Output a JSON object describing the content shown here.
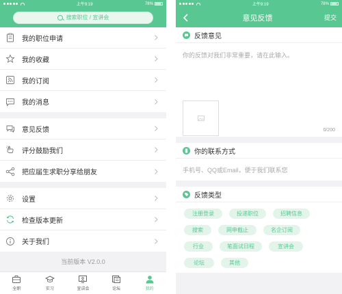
{
  "colors": {
    "accent": "#58c792",
    "tag_bg": "#e3f5eb",
    "page_bg": "#f2f2f4"
  },
  "left": {
    "status": {
      "time": "上午9:19",
      "battery": "78%"
    },
    "search": {
      "placeholder": "搜索职位 / 宣讲会",
      "icon": "search-icon"
    },
    "groups": [
      [
        {
          "label": "我的职位申请",
          "icon": "clipboard-icon"
        },
        {
          "label": "我的收藏",
          "icon": "star-icon"
        },
        {
          "label": "我的订阅",
          "icon": "rss-icon"
        },
        {
          "label": "我的消息",
          "icon": "message-icon"
        }
      ],
      [
        {
          "label": "意见反馈",
          "icon": "feedback-icon"
        },
        {
          "label": "评分鼓励我们",
          "icon": "thumbs-up-icon"
        },
        {
          "label": "把应届生求职分享给朋友",
          "icon": "share-icon"
        }
      ],
      [
        {
          "label": "设置",
          "icon": "gear-icon"
        },
        {
          "label": "检查版本更新",
          "icon": "refresh-icon"
        },
        {
          "label": "关于我们",
          "icon": "info-icon"
        }
      ]
    ],
    "version": "当前版本 V2.0.0",
    "tabs": [
      {
        "label": "全职",
        "icon": "briefcase-icon",
        "active": false
      },
      {
        "label": "实习",
        "icon": "graduation-cap-icon",
        "active": false
      },
      {
        "label": "宣讲会",
        "icon": "presentation-icon",
        "active": false
      },
      {
        "label": "论坛",
        "icon": "forum-icon",
        "active": false
      },
      {
        "label": "我的",
        "icon": "user-icon",
        "active": true
      }
    ]
  },
  "right": {
    "status": {
      "time": "上午9:19",
      "battery": "78%"
    },
    "header": {
      "title": "意见反馈",
      "submit": "提交"
    },
    "feedback": {
      "title": "反馈意见",
      "placeholder": "你的反馈对我们非常重要，请在此输入。",
      "counter": "0/200"
    },
    "contact": {
      "title": "你的联系方式",
      "placeholder": "手机号、QQ或Email，便于我们联系您"
    },
    "types": {
      "title": "反馈类型",
      "tags": [
        "注册登录",
        "投递职位",
        "招聘信息",
        "搜索",
        "网申截止",
        "名企订阅",
        "行业",
        "笔面试日程",
        "宣讲会",
        "论坛",
        "其他"
      ]
    }
  }
}
